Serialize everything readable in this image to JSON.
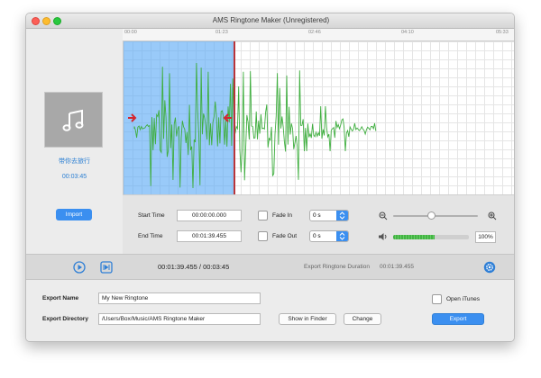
{
  "window": {
    "title": "AMS Ringtone Maker (Unregistered)"
  },
  "timeline": {
    "ticks": [
      "00:00",
      "01:23",
      "02:46",
      "04:10",
      "05:33"
    ]
  },
  "left_panel": {
    "song_title": "带你去旅行",
    "song_duration": "00:03:45",
    "import_label": "Import",
    "art_icon": "music-note-icon"
  },
  "waveform": {
    "selection_fraction": 0.36,
    "wave_color": "#3fae3f",
    "selection_color": "#5aaaf5"
  },
  "controls": {
    "start_time_label": "Start Time",
    "start_time_value": "00:00:00.000",
    "end_time_label": "End Time",
    "end_time_value": "00:01:39.455",
    "fade_in_label": "Fade In",
    "fade_in_value": "0 s",
    "fade_out_label": "Fade Out",
    "fade_out_value": "0 s",
    "zoom_level": 0.45,
    "volume_level": 0.55,
    "volume_percent": "100%"
  },
  "transport": {
    "current_time": "00:01:39.455",
    "separator": "/",
    "total_time": "00:03:45",
    "export_duration_label": "Export Ringtone Duration",
    "export_duration_value": "00:01:39.455"
  },
  "export": {
    "name_label": "Export Name",
    "name_value": "My New Ringtone",
    "directory_label": "Export Directory",
    "directory_value": "/Users/Box/Music/AMS Ringtone Maker",
    "show_in_finder_label": "Show in Finder",
    "change_label": "Change",
    "open_itunes_label": "Open iTunes",
    "export_label": "Export"
  },
  "colors": {
    "accent": "#3b8ff0",
    "link_text": "#2b7fd3"
  }
}
